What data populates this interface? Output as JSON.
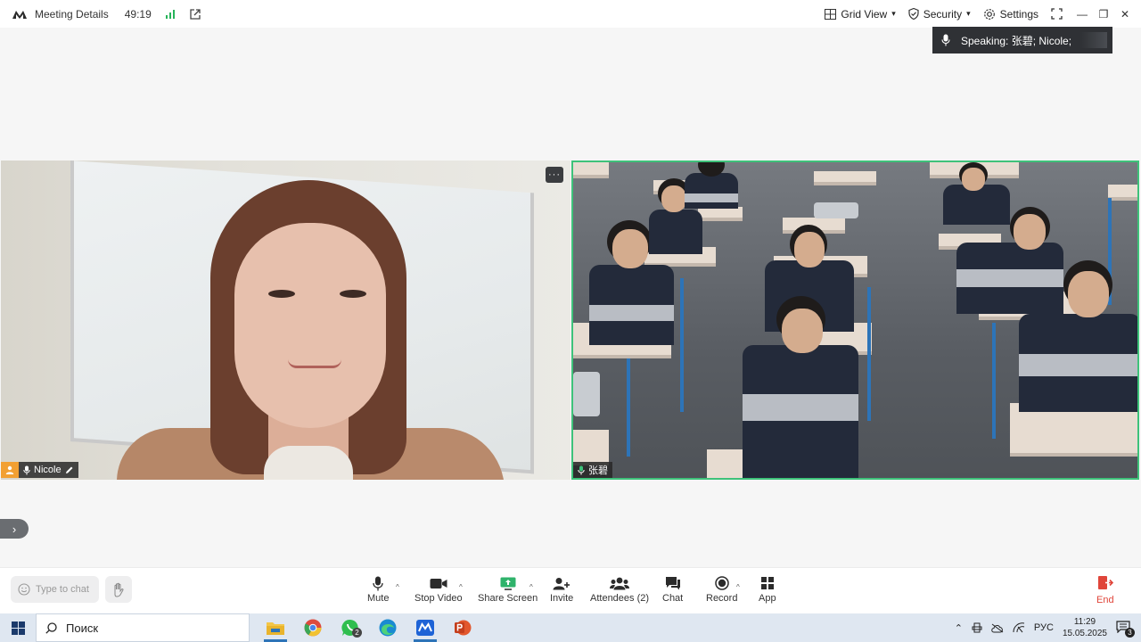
{
  "topbar": {
    "title": "Meeting Details",
    "timer": "49:19",
    "view_label": "Grid View",
    "security_label": "Security",
    "settings_label": "Settings"
  },
  "speaking": {
    "text": "Speaking:  张碧; Nicole;"
  },
  "tiles": [
    {
      "name": "Nicole"
    },
    {
      "name": "张碧"
    }
  ],
  "more_label": "···",
  "chat": {
    "placeholder": "Type to chat"
  },
  "toolbar": {
    "mute": "Mute",
    "stop_video": "Stop Video",
    "share_screen": "Share Screen",
    "invite": "Invite",
    "attendees": "Attendees (2)",
    "chat": "Chat",
    "record": "Record",
    "app": "App",
    "end": "End"
  },
  "taskbar": {
    "search_placeholder": "Поиск",
    "whatsapp_badge": "2",
    "lang": "РУС",
    "time": "11:29",
    "date": "15.05.2025",
    "notification_badge": "3"
  },
  "colors": {
    "accent_green": "#3ec27a",
    "end_red": "#e0453a",
    "host_orange": "#f2a033"
  }
}
